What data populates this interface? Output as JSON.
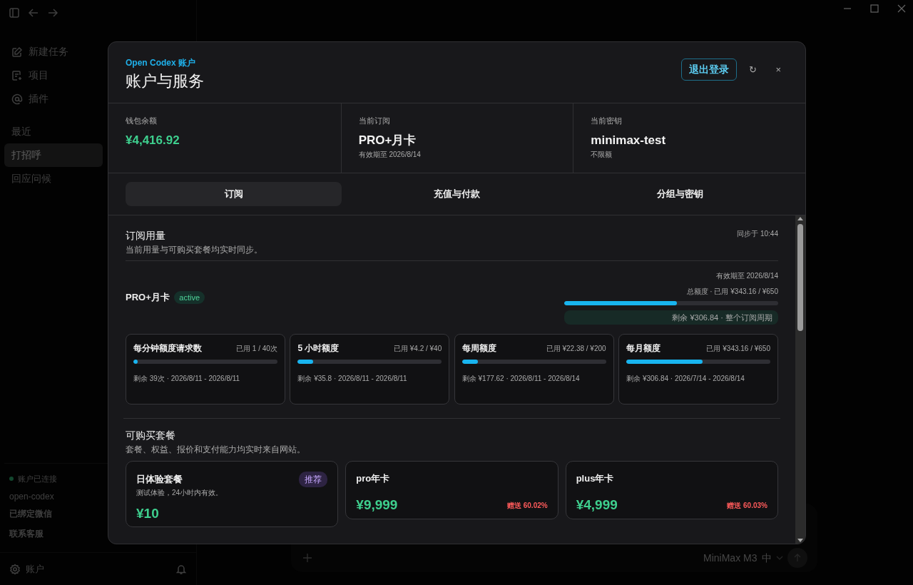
{
  "sidebar": {
    "items": [
      {
        "label": "新建任务"
      },
      {
        "label": "项目"
      },
      {
        "label": "插件"
      }
    ],
    "recent_label": "最近",
    "recent": [
      {
        "label": "打招呼",
        "selected": true
      },
      {
        "label": "回应问候",
        "selected": false
      }
    ],
    "status": {
      "label": "账户已连接",
      "connected": true
    },
    "account": "open-codex",
    "links": [
      "已绑定微信",
      "联系客服"
    ],
    "footer": "账户"
  },
  "composer": {
    "model": "MiniMax M3",
    "effort": "中"
  },
  "modal": {
    "eyebrow": "Open Codex 账户",
    "title": "账户与服务",
    "logout": "退出登录",
    "refresh": "↻",
    "close": "×",
    "summary": [
      {
        "label": "钱包余额",
        "value": "¥4,416.92",
        "kind": "money"
      },
      {
        "label": "当前订阅",
        "value": "PRO+月卡",
        "sub": "有效期至 2026/8/14",
        "kind": "plain"
      },
      {
        "label": "当前密钥",
        "value": "minimax-test",
        "sub": "不限额",
        "kind": "plain"
      }
    ],
    "tabs": [
      {
        "label": "订阅",
        "selected": true
      },
      {
        "label": "充值与付款",
        "selected": false
      },
      {
        "label": "分组与密钥",
        "selected": false
      }
    ],
    "usage": {
      "title": "订阅用量",
      "subtitle": "当前用量与可购买套餐均实时同步。",
      "synced": "同步于 10:44",
      "plan": {
        "name": "PRO+月卡",
        "status": "active",
        "expiry": "有效期至 2026/8/14",
        "total": "总额度 · 已用 ¥343.16 / ¥650",
        "level": 0.528,
        "remaining": "剩余 ¥306.84 · 整个订阅周期"
      },
      "quotas": [
        {
          "name": "每分钟额度请求数",
          "used": "已用 1 / 40次",
          "level": 0.025,
          "footer": "剩余 39次 · 2026/8/11 - 2026/8/11"
        },
        {
          "name": "5 小时额度",
          "used": "已用 ¥4.2 / ¥40",
          "level": 0.105,
          "footer": "剩余 ¥35.8 · 2026/8/11 - 2026/8/11"
        },
        {
          "name": "每周额度",
          "used": "已用 ¥22.38 / ¥200",
          "level": 0.112,
          "footer": "剩余 ¥177.62 · 2026/8/11 - 2026/8/14"
        },
        {
          "name": "每月额度",
          "used": "已用 ¥343.16 / ¥650",
          "level": 0.528,
          "footer": "剩余 ¥306.84 · 2026/7/14 - 2026/8/14"
        }
      ]
    },
    "plans": {
      "title": "可购买套餐",
      "subtitle": "套餐、权益、报价和支付能力均实时来自网站。",
      "items": [
        {
          "name": "日体验套餐",
          "badge": "推荐",
          "desc": "测试体验，24小时内有效。",
          "price": "¥10"
        },
        {
          "name": "pro年卡",
          "price": "¥9,999",
          "bonus": "赠送 60.02%"
        },
        {
          "name": "plus年卡",
          "price": "¥4,999",
          "bonus": "赠送 60.03%"
        }
      ]
    }
  }
}
